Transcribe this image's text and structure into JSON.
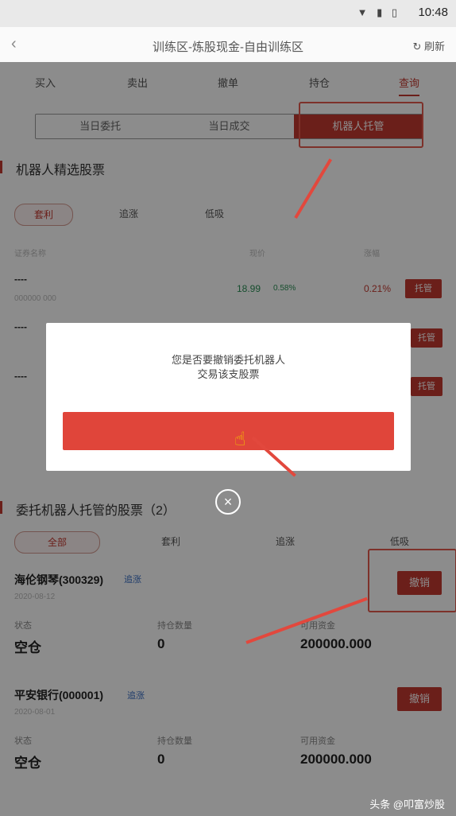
{
  "status": {
    "time": "10:48",
    "icons": "▼ ▮ ▯"
  },
  "nav": {
    "back": "‹",
    "title": "训练区-炼股现金-自由训练区",
    "refresh": "↻ 刷新"
  },
  "tabs": [
    "买入",
    "卖出",
    "撤单",
    "持仓",
    "查询"
  ],
  "segments": [
    "当日委托",
    "当日成交",
    "机器人托管"
  ],
  "robot_section": {
    "title": "机器人精选股票",
    "filters": [
      "套利",
      "追涨",
      "低吸"
    ],
    "headers": [
      "证券名称",
      "现价",
      "涨幅"
    ],
    "rows": [
      {
        "name": "----",
        "code": "000000 000",
        "price": "18.99",
        "change": "0.58%",
        "pct": "0.21%",
        "btn": "托管"
      },
      {
        "name": "----",
        "code": "",
        "price": "",
        "change": "",
        "pct": "",
        "btn": "托管"
      },
      {
        "name": "----",
        "code": "",
        "price": "",
        "change": "",
        "pct": "",
        "btn": "托管"
      }
    ]
  },
  "dialog": {
    "line1": "您是否要撤销委托机器人",
    "line2": "交易该支股票",
    "close_icon": "×"
  },
  "managed_section": {
    "title": "委托机器人托管的股票（2）",
    "filters": [
      "全部",
      "套利",
      "追涨",
      "低吸"
    ],
    "stocks": [
      {
        "name": "海伦钢琴(300329)",
        "tag": "追涨",
        "date": "2020-08-12",
        "btn": "撤销",
        "labels": [
          "状态",
          "持仓数量",
          "可用资金"
        ],
        "status": "空仓",
        "qty": "0",
        "funds": "200000.000"
      },
      {
        "name": "平安银行(000001)",
        "tag": "追涨",
        "date": "2020-08-01",
        "btn": "撤销",
        "labels": [
          "状态",
          "持仓数量",
          "可用资金"
        ],
        "status": "空仓",
        "qty": "0",
        "funds": "200000.000"
      }
    ]
  },
  "watermark": "头条 @叩富炒股"
}
